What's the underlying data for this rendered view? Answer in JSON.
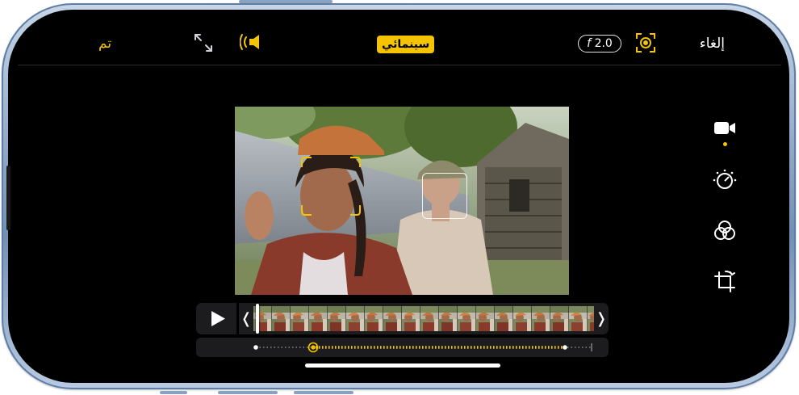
{
  "toolbar": {
    "done_label": "تم",
    "cancel_label": "إلغاء",
    "cinematic_badge": "سينمائي",
    "aperture_prefix": "f",
    "aperture_value": "2.0",
    "icons": [
      "expand-icon",
      "audio-icon",
      "focus-mode-icon"
    ]
  },
  "side_tools": [
    {
      "name": "video-tool",
      "icon": "video-camera-icon",
      "active": true
    },
    {
      "name": "adjust-tool",
      "icon": "adjust-dial-icon",
      "active": false
    },
    {
      "name": "filters-tool",
      "icon": "filters-icon",
      "active": false
    },
    {
      "name": "crop-tool",
      "icon": "crop-rotate-icon",
      "active": false
    }
  ],
  "timeline": {
    "play_icon": "play-icon",
    "trim_left_glyph": "❬",
    "trim_right_glyph": "❭",
    "playhead_position": 0.0
  },
  "colors": {
    "accent": "#f5c400",
    "background": "#000000",
    "frame": "#8ea6c4"
  }
}
